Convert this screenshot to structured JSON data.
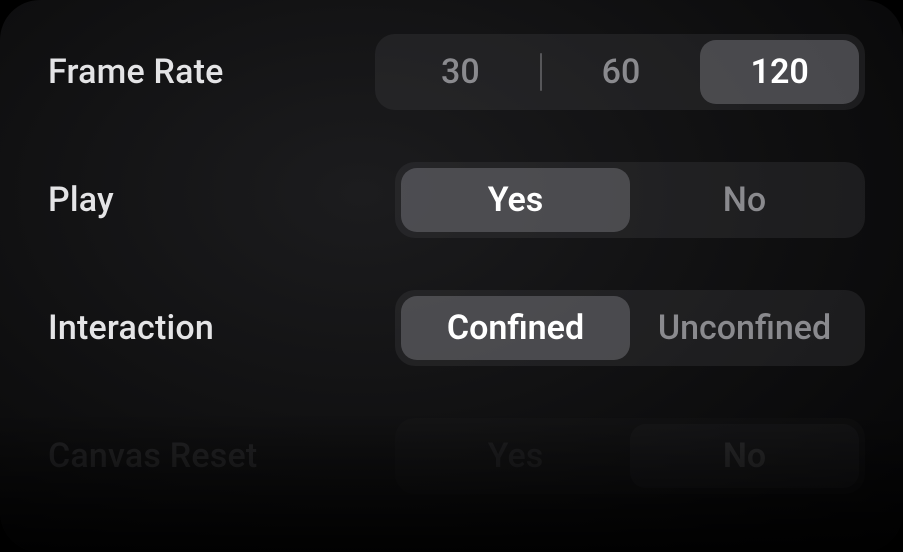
{
  "settings": {
    "frame_rate": {
      "label": "Frame Rate",
      "options": [
        "30",
        "60",
        "120"
      ],
      "selected": "120"
    },
    "play": {
      "label": "Play",
      "options": [
        "Yes",
        "No"
      ],
      "selected": "Yes"
    },
    "interaction": {
      "label": "Interaction",
      "options": [
        "Confined",
        "Unconfined"
      ],
      "selected": "Confined"
    },
    "canvas_reset": {
      "label": "Canvas Reset",
      "options": [
        "Yes",
        "No"
      ],
      "selected": "No"
    }
  }
}
